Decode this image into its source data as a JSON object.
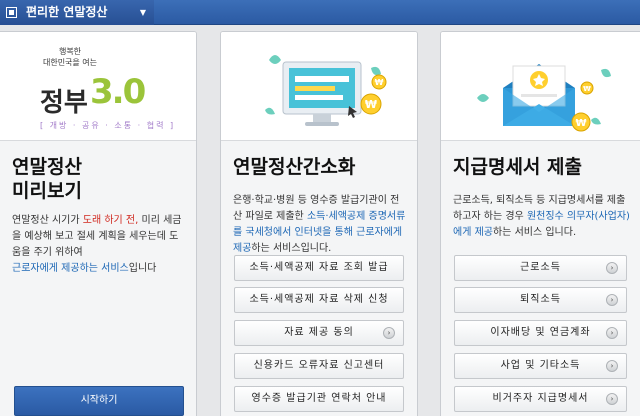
{
  "topbar": {
    "menu_label": "편리한 연말정산"
  },
  "col1": {
    "logo_line1": "행복한",
    "logo_line2": "대한민국을 여는",
    "logo_word": "정부",
    "logo_version": "3.0",
    "logo_tagline": "[ 개방 · 공유 · 소통 · 협력 ]",
    "title_line1": "연말정산",
    "title_line2": "미리보기",
    "desc_a": "연말정산 시기가 ",
    "desc_red": "도래 하기 전,",
    "desc_b": " 미리 세금을 예상해 보고 절세 계획을 세우는데 도움을 주기 위하여",
    "desc_blue": "근로자에게 제공하는 서비스",
    "desc_c": "입니다",
    "start_button": "시작하기"
  },
  "col2": {
    "title": "연말정산간소화",
    "desc_a": "은행·학교·병원 등 영수증 발급기관이 전산 파일로 제출한 ",
    "desc_blue1": "소득·세액공제 증명서류를 국세청에서 인터넷을 통해 근로자에게 제공",
    "desc_b": "하는 서비스입니다.",
    "buttons": [
      {
        "label": "소득·세액공제 자료 조회 발급",
        "arrow": false
      },
      {
        "label": "소득·세액공제 자료 삭제 신청",
        "arrow": false
      },
      {
        "label": "자료 제공 동의",
        "arrow": true
      },
      {
        "label": "신용카드 오류자료 신고센터",
        "arrow": false
      },
      {
        "label": "영수증 발급기관 연락처 안내",
        "arrow": false
      }
    ]
  },
  "col3": {
    "title": "지급명세서 제출",
    "desc_a": "근로소득, 퇴직소득 등 지급명세서를 제출하고자 하는 경우 ",
    "desc_blue": "원천징수 의무자(사업자)에게 제공",
    "desc_b": "하는 서비스 입니다.",
    "buttons": [
      {
        "label": "근로소득",
        "arrow": true
      },
      {
        "label": "퇴직소득",
        "arrow": true
      },
      {
        "label": "이자배당 및 연금계좌",
        "arrow": true
      },
      {
        "label": "사업 및 기타소득",
        "arrow": true
      },
      {
        "label": "비거주자 지급명세서",
        "arrow": true
      }
    ]
  },
  "colors": {
    "brand_blue": "#2b5aa3",
    "accent_red": "#d0281f",
    "link_blue": "#1d67b5"
  }
}
